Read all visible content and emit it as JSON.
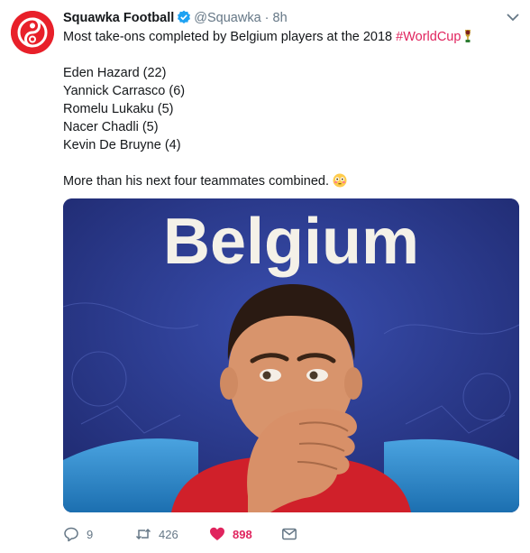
{
  "tweet": {
    "author_name": "Squawka Football",
    "handle": "@Squawka",
    "separator": "·",
    "time": "8h",
    "intro_text": "Most take-ons completed by Belgium players at the 2018 ",
    "hashtag": "#WorldCup",
    "list": [
      "Eden Hazard (22)",
      "Yannick Carrasco (6)",
      "Romelu Lukaku (5)",
      "Nacer Chadli (5)",
      "Kevin De Bruyne (4)"
    ],
    "closing_text": "More than his next four teammates combined.",
    "media": {
      "banner_text": "Belgium"
    }
  },
  "actions": {
    "reply_count": "9",
    "retweet_count": "426",
    "like_count": "898"
  },
  "colors": {
    "brand_red": "#e8202a",
    "like_pink": "#e0245e",
    "verified_blue": "#1da1f2",
    "muted_gray": "#657786"
  },
  "icons": [
    "squawka-logo-icon",
    "verified-badge-icon",
    "chevron-down-icon",
    "trophy-icon",
    "flushed-face-icon",
    "reply-icon",
    "retweet-icon",
    "heart-icon",
    "direct-message-icon"
  ]
}
